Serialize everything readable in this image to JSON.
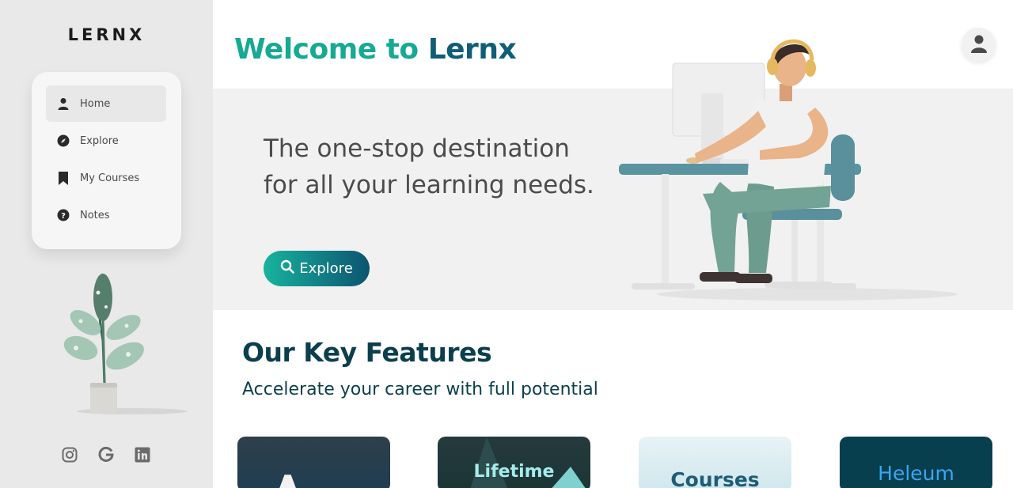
{
  "brand": {
    "logo": "LERNX"
  },
  "sidebar": {
    "items": [
      {
        "label": "Home",
        "icon": "user-icon",
        "active": true
      },
      {
        "label": "Explore",
        "icon": "compass-icon",
        "active": false
      },
      {
        "label": "My Courses",
        "icon": "bookmark-icon",
        "active": false
      },
      {
        "label": "Notes",
        "icon": "question-icon",
        "active": false
      }
    ],
    "socials": [
      "instagram-icon",
      "google-icon",
      "linkedin-icon"
    ]
  },
  "header": {
    "welcome_part1": "Welcome to",
    "welcome_part2": "Lernx"
  },
  "hero": {
    "tagline": "The one-stop destination for all your learning needs.",
    "explore_label": "Explore"
  },
  "features": {
    "title": "Our Key Features",
    "subtitle": "Accelerate your career with full potential",
    "cards": [
      {
        "label": "A"
      },
      {
        "label": "Lifetime"
      },
      {
        "label": "Courses"
      },
      {
        "label": "Heleum"
      }
    ]
  },
  "colors": {
    "accent_teal": "#16a994",
    "accent_dark": "#0f5e76",
    "heading_dark": "#0b3f4d",
    "sidebar_bg": "#e9e9e9",
    "hero_bg": "#f1f1f1"
  }
}
